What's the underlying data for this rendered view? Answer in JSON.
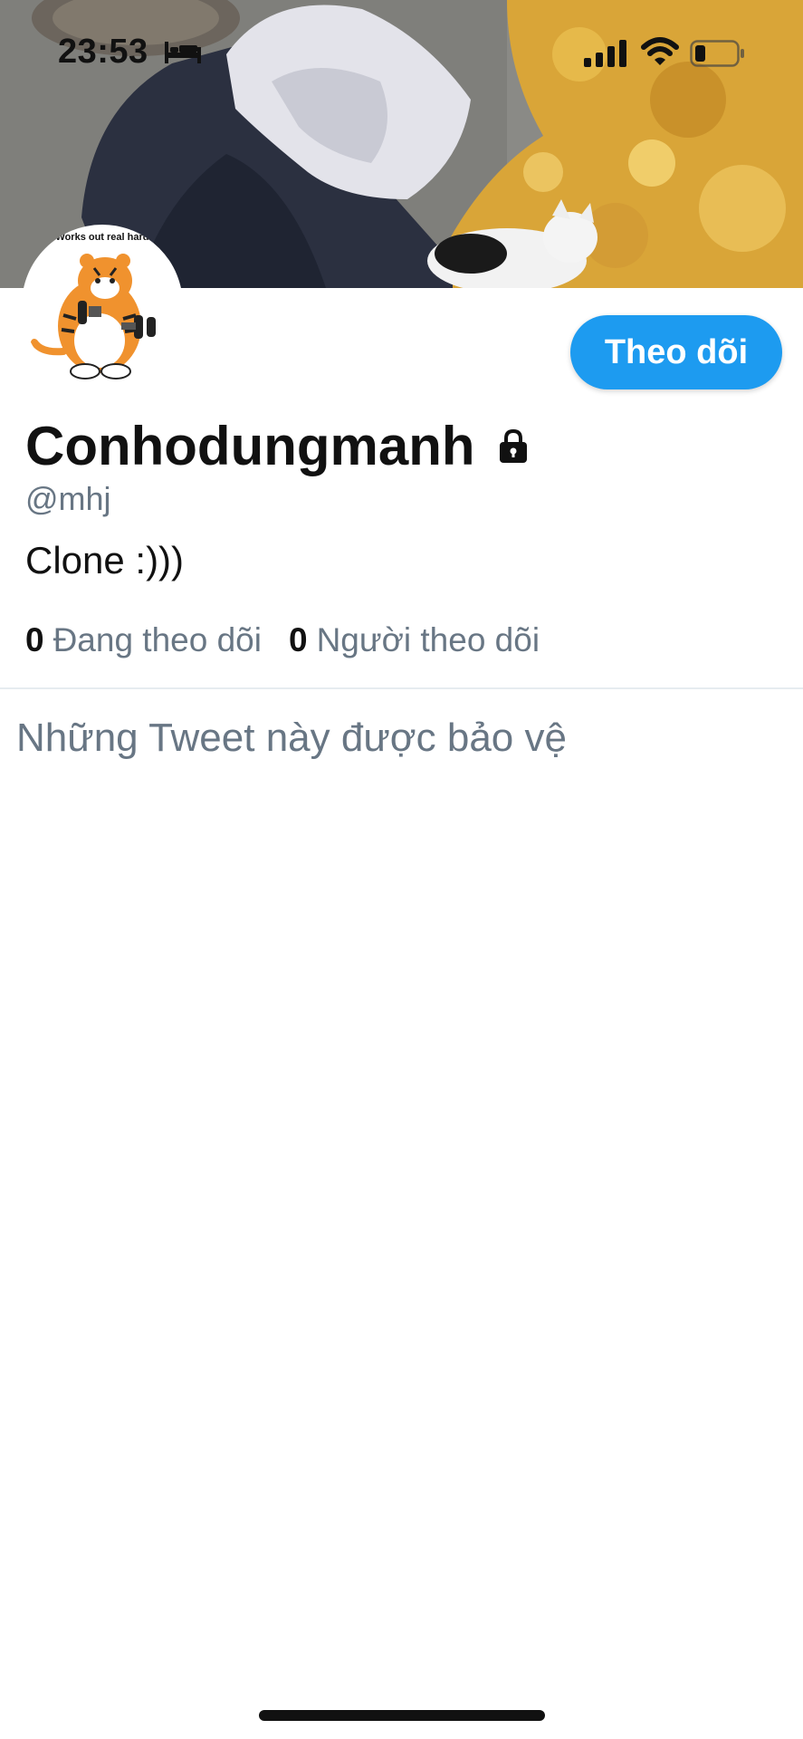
{
  "status_bar": {
    "time": "23:53",
    "icons": [
      "bed-icon",
      "cellular-signal-icon",
      "wifi-icon",
      "battery-icon"
    ]
  },
  "banner": {
    "description_icon": "profile-banner-photo"
  },
  "avatar": {
    "caption": "Works out real hard..",
    "icon": "tiger-lifting-dumbbells-avatar"
  },
  "profile": {
    "display_name": "Conhodungmanh",
    "protected_icon": "lock-icon",
    "handle": "@mhj",
    "bio": "Clone :)))"
  },
  "stats": {
    "following_count": "0",
    "following_label": "Đang theo dõi",
    "followers_count": "0",
    "followers_label": "Người theo dõi"
  },
  "actions": {
    "follow_label": "Theo dõi"
  },
  "content": {
    "protected_notice": "Những Tweet này được bảo vệ"
  },
  "colors": {
    "accent": "#1d9bf0",
    "secondary_text": "#687684",
    "primary_text": "#111111",
    "divider": "#e6ecf0"
  }
}
